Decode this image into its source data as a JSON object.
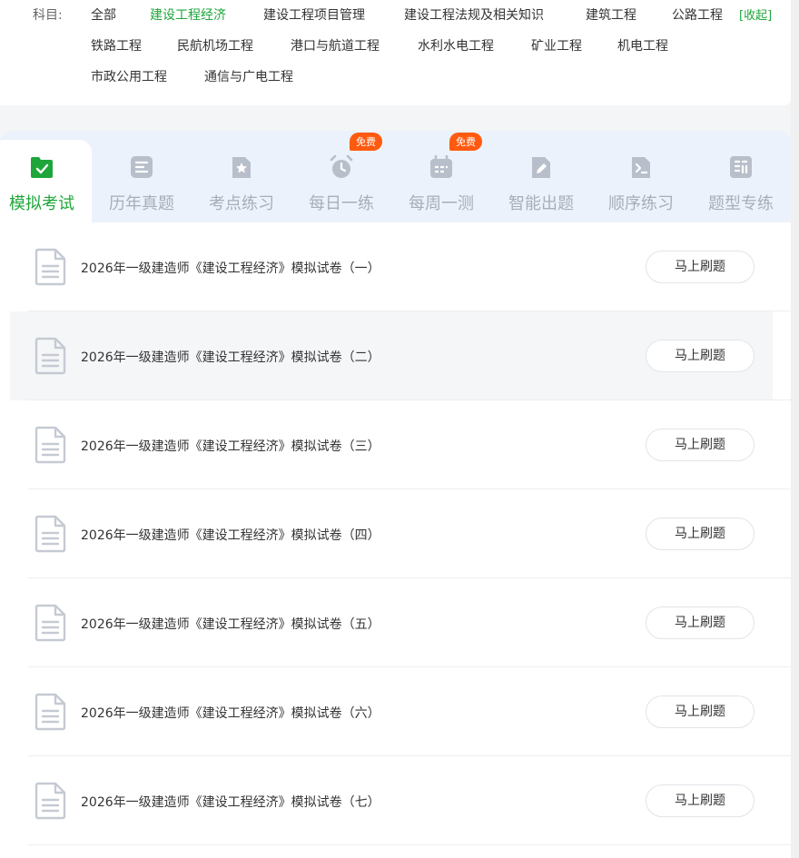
{
  "subjects": {
    "label": "科目:",
    "items": [
      {
        "label": "全部"
      },
      {
        "label": "建设工程经济"
      },
      {
        "label": "建设工程项目管理"
      },
      {
        "label": "建设工程法规及相关知识"
      },
      {
        "label": "建筑工程"
      },
      {
        "label": "公路工程"
      },
      {
        "label": "铁路工程"
      },
      {
        "label": "民航机场工程"
      },
      {
        "label": "港口与航道工程"
      },
      {
        "label": "水利水电工程"
      },
      {
        "label": "矿业工程"
      },
      {
        "label": "机电工程"
      },
      {
        "label": "市政公用工程"
      },
      {
        "label": "通信与广电工程"
      }
    ],
    "active": "建设工程经济",
    "collapse_label": "[收起]"
  },
  "tabs": [
    {
      "label": "模拟考试",
      "icon": "check-doc-icon"
    },
    {
      "label": "历年真题",
      "icon": "list-doc-icon"
    },
    {
      "label": "考点练习",
      "icon": "star-doc-icon"
    },
    {
      "label": "每日一练",
      "icon": "alarm-clock-icon",
      "badge": "免费"
    },
    {
      "label": "每周一测",
      "icon": "calendar-icon",
      "badge": "免费"
    },
    {
      "label": "智能出题",
      "icon": "edit-doc-icon"
    },
    {
      "label": "顺序练习",
      "icon": "code-doc-icon"
    },
    {
      "label": "题型专练",
      "icon": "grid-doc-icon"
    }
  ],
  "active_tab": "模拟考试",
  "colors": {
    "accent": "#1ea63a",
    "badge": "#ff5a10",
    "tab_inactive": "#a8adb8",
    "tab_bar_bg": "#ecf2fb"
  },
  "exams": [
    {
      "title": "2026年一级建造师《建设工程经济》模拟试卷（一）",
      "action": "马上刷题"
    },
    {
      "title": "2026年一级建造师《建设工程经济》模拟试卷（二）",
      "action": "马上刷题"
    },
    {
      "title": "2026年一级建造师《建设工程经济》模拟试卷（三）",
      "action": "马上刷题"
    },
    {
      "title": "2026年一级建造师《建设工程经济》模拟试卷（四）",
      "action": "马上刷题"
    },
    {
      "title": "2026年一级建造师《建设工程经济》模拟试卷（五）",
      "action": "马上刷题"
    },
    {
      "title": "2026年一级建造师《建设工程经济》模拟试卷（六）",
      "action": "马上刷题"
    },
    {
      "title": "2026年一级建造师《建设工程经济》模拟试卷（七）",
      "action": "马上刷题"
    }
  ]
}
